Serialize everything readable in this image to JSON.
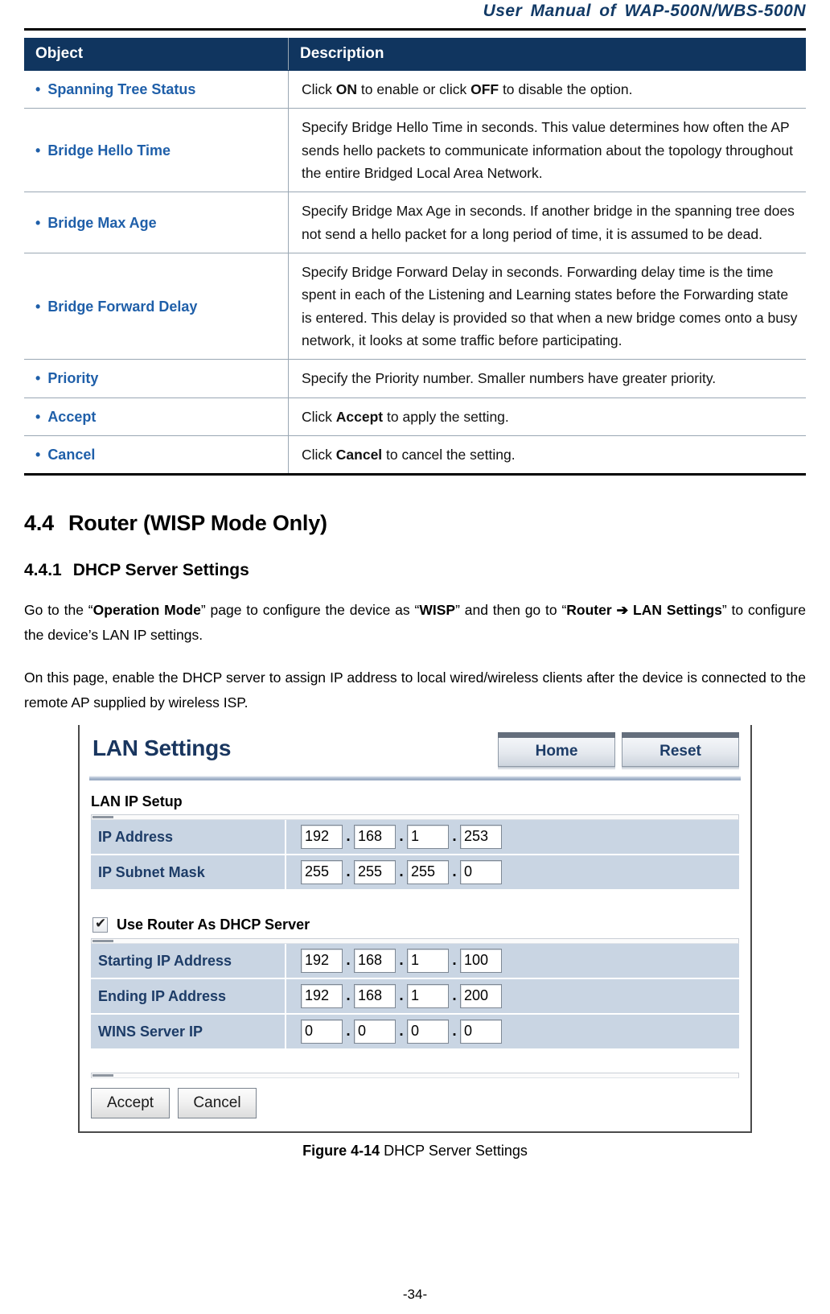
{
  "header": {
    "running_title": "User Manual of WAP-500N/WBS-500N"
  },
  "object_table": {
    "columns": [
      "Object",
      "Description"
    ],
    "rows": [
      {
        "object": "Spanning Tree Status",
        "desc_parts": [
          {
            "t": "Click ",
            "b": false
          },
          {
            "t": "ON",
            "b": true
          },
          {
            "t": " to enable or click ",
            "b": false
          },
          {
            "t": "OFF",
            "b": true
          },
          {
            "t": " to disable the option.",
            "b": false
          }
        ]
      },
      {
        "object": "Bridge Hello Time",
        "desc_parts": [
          {
            "t": "Specify Bridge Hello Time in seconds. This value determines how often the AP sends hello packets to communicate information about the topology throughout the entire Bridged Local Area Network.",
            "b": false
          }
        ]
      },
      {
        "object": "Bridge Max Age",
        "desc_parts": [
          {
            "t": "Specify Bridge Max Age in seconds. If another bridge in the spanning tree does not send a hello packet for a long period of time, it is assumed to be dead.",
            "b": false
          }
        ]
      },
      {
        "object": "Bridge Forward Delay",
        "desc_parts": [
          {
            "t": "Specify Bridge Forward Delay in seconds. Forwarding delay time is the time spent in each of the Listening and Learning states before the Forwarding state is entered. This delay is provided so that when a new bridge comes onto a busy network, it looks at some traffic before participating.",
            "b": false
          }
        ]
      },
      {
        "object": "Priority",
        "desc_parts": [
          {
            "t": "Specify the Priority number. Smaller numbers have greater priority.",
            "b": false
          }
        ]
      },
      {
        "object": "Accept",
        "desc_parts": [
          {
            "t": "Click ",
            "b": false
          },
          {
            "t": "Accept",
            "b": true
          },
          {
            "t": " to apply the setting.",
            "b": false
          }
        ]
      },
      {
        "object": "Cancel",
        "desc_parts": [
          {
            "t": "Click ",
            "b": false
          },
          {
            "t": "Cancel",
            "b": true
          },
          {
            "t": " to cancel the setting.",
            "b": false
          }
        ]
      }
    ]
  },
  "section": {
    "number": "4.4",
    "title": "Router (WISP Mode Only)"
  },
  "subsection": {
    "number": "4.4.1",
    "title": "DHCP Server Settings"
  },
  "paragraphs": [
    [
      {
        "t": "Go to the “",
        "b": false
      },
      {
        "t": "Operation Mode",
        "b": true
      },
      {
        "t": "” page to configure the device as “",
        "b": false
      },
      {
        "t": "WISP",
        "b": true
      },
      {
        "t": "” and then go to “",
        "b": false
      },
      {
        "t": "Router ➔ LAN Settings",
        "b": true
      },
      {
        "t": "” to configure the device’s LAN IP settings.",
        "b": false
      }
    ],
    [
      {
        "t": "On this page, enable the DHCP server to assign IP address to local wired/wireless clients after the device is connected to the remote AP supplied by wireless ISP.",
        "b": false
      }
    ]
  ],
  "screenshot": {
    "title": "LAN Settings",
    "nav_buttons": [
      {
        "label": "Home",
        "name": "home-button"
      },
      {
        "label": "Reset",
        "name": "reset-button"
      }
    ],
    "lan_group_label": "LAN IP Setup",
    "lan_rows": [
      {
        "label": "IP Address",
        "octets": [
          "192",
          "168",
          "1",
          "253"
        ]
      },
      {
        "label": "IP Subnet Mask",
        "octets": [
          "255",
          "255",
          "255",
          "0"
        ]
      }
    ],
    "dhcp_checkbox": {
      "label": "Use Router As DHCP Server",
      "checked": true,
      "tick": "✔"
    },
    "dhcp_rows": [
      {
        "label": "Starting IP Address",
        "octets": [
          "192",
          "168",
          "1",
          "100"
        ]
      },
      {
        "label": "Ending IP Address",
        "octets": [
          "192",
          "168",
          "1",
          "200"
        ]
      },
      {
        "label": "WINS Server IP",
        "octets": [
          "0",
          "0",
          "0",
          "0"
        ]
      }
    ],
    "action_buttons": [
      {
        "label": "Accept",
        "name": "accept-button"
      },
      {
        "label": "Cancel",
        "name": "cancel-button"
      }
    ],
    "separator": "."
  },
  "figure": {
    "number": "Figure 4-14",
    "caption": "DHCP Server Settings"
  },
  "page_number": "-34-",
  "colors": {
    "table_header_bg": "#10355f",
    "object_label": "#1f5fa9",
    "panel_row_bg": "#c9d5e3",
    "panel_label": "#1d3c67",
    "running_header": "#123a66"
  }
}
